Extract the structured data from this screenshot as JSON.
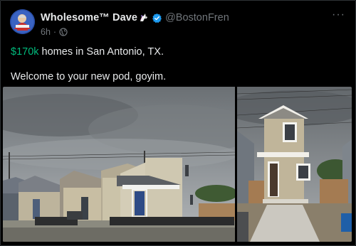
{
  "author": {
    "display_name": "Wholesome™ Dave",
    "name_emoji": "unicorn-icon",
    "verified": true,
    "handle": "@BostonFren",
    "avatar": "avatar-icon"
  },
  "meta": {
    "timestamp": "6h",
    "separator": "·",
    "audience_icon": "globe-icon"
  },
  "menu": {
    "more_label": "···"
  },
  "post": {
    "cashtag": "$170k",
    "line1_rest": " homes in San Antonio, TX.",
    "line2": "Welcome to your new pod, goyim."
  },
  "media": {
    "photos": [
      {
        "name": "row-houses-photo"
      },
      {
        "name": "two-story-house-photo"
      }
    ]
  },
  "colors": {
    "background": "#000000",
    "text": "#e7e9ea",
    "secondary": "#71767b",
    "cashtag": "#00ba7c",
    "verified": "#1d9bf0"
  }
}
